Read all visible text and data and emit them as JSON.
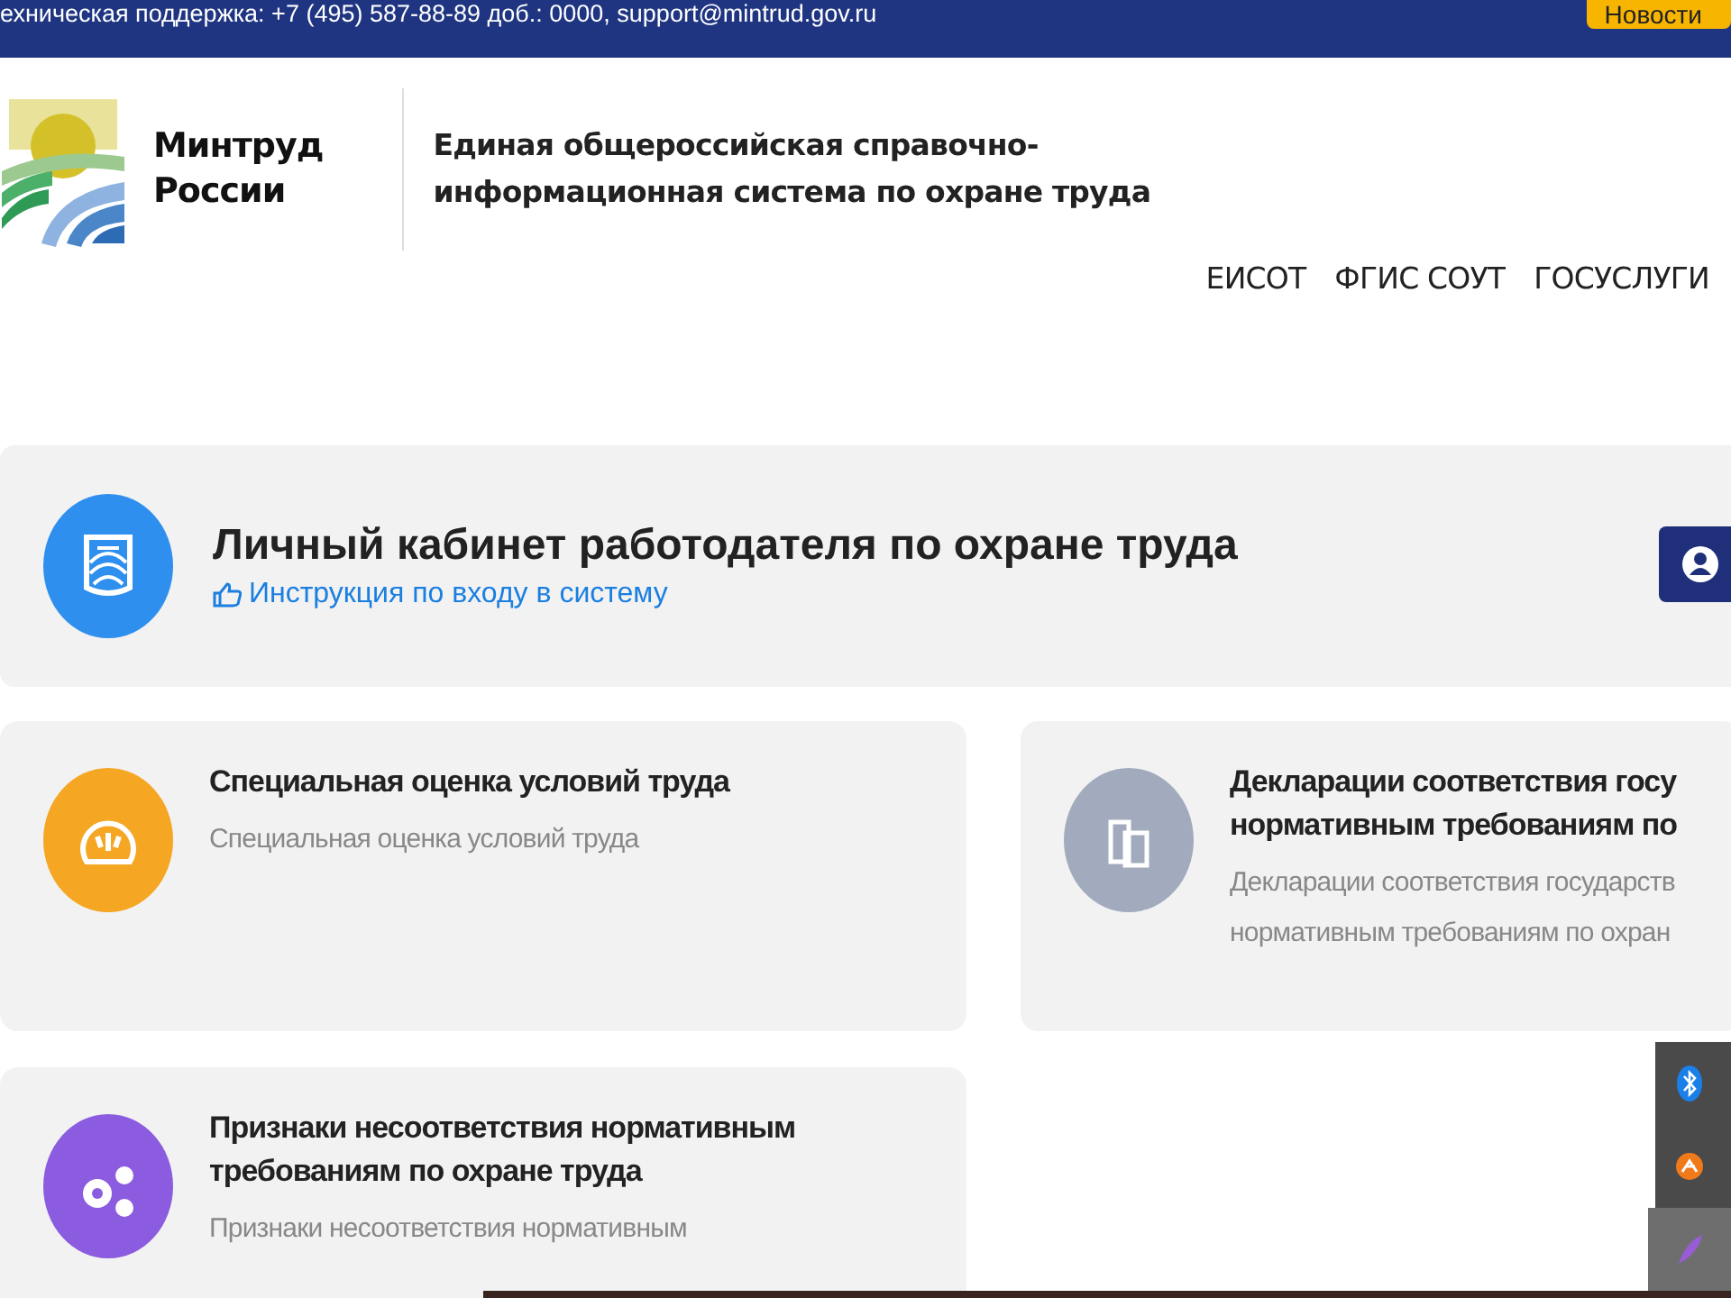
{
  "top_bar": {
    "support_text": "ехническая поддержка: +7 (495) 587-88-89 доб.: 0000, support@mintrud.gov.ru",
    "news_button": "Новости"
  },
  "header": {
    "logo_lines": [
      "Минтруд",
      "России"
    ],
    "system_title_lines": [
      "Единая общероссийская справочно-",
      "информационная система по охране труда"
    ],
    "nav": [
      "ЕИСОТ",
      "ФГИС СОУТ",
      "ГОСУСЛУГИ"
    ]
  },
  "cabinet": {
    "title": "Личный кабинет работодателя по охране труда",
    "instruction_link": "Инструкция по входу в систему"
  },
  "cards": [
    {
      "kind": "assessment",
      "color": "#f5a623",
      "title_lines": [
        "Специальная оценка условий труда"
      ],
      "description_lines": [
        "Специальная оценка условий труда"
      ]
    },
    {
      "kind": "declarations",
      "color": "#a2abbd",
      "title_lines": [
        "Декларации соответствия госу",
        "нормативным требованиям по"
      ],
      "description_lines": [
        "Декларации соответствия государств",
        "нормативным требованиям по охран"
      ]
    },
    {
      "kind": "violations",
      "color": "#8b5be0",
      "title_lines": [
        "Признаки несоответствия нормативным",
        "требованиям по охране труда"
      ],
      "description_lines": [
        "Признаки несоответствия нормативным"
      ]
    }
  ],
  "tray": [
    {
      "kind": "bluetooth",
      "selected": false
    },
    {
      "kind": "app",
      "selected": false
    },
    {
      "kind": "feather",
      "selected": true
    }
  ]
}
